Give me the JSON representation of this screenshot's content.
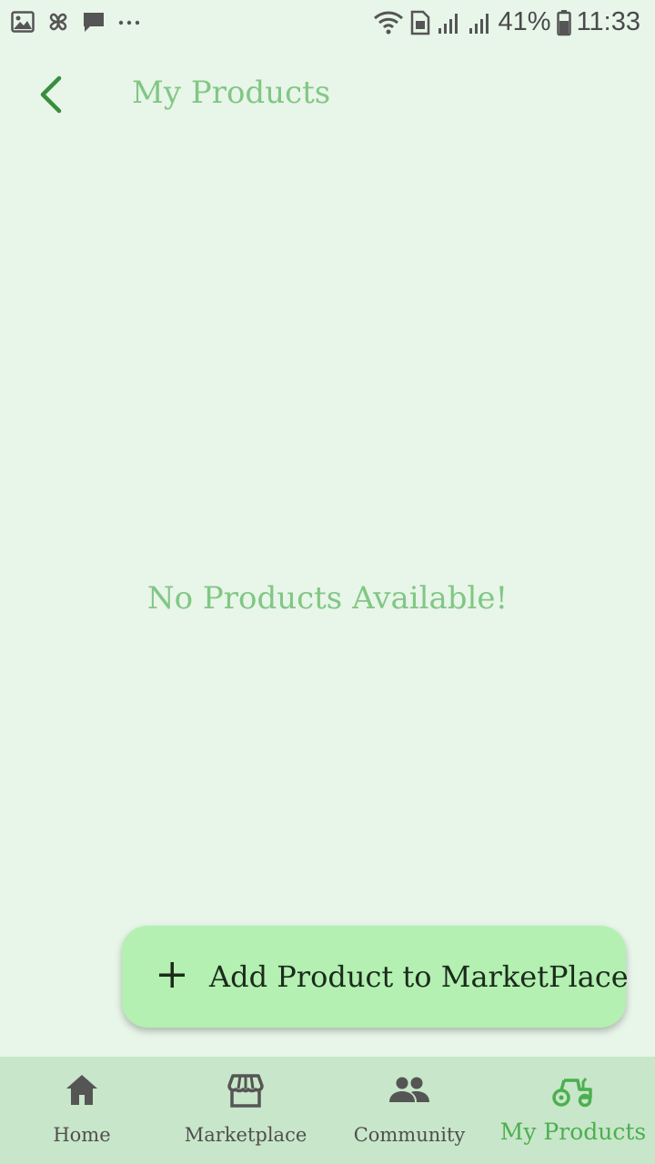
{
  "status_bar": {
    "battery": "41%",
    "time": "11:33",
    "icons": [
      "gallery-icon",
      "pinwheel-icon",
      "message-icon",
      "more-dots-icon",
      "wifi-icon",
      "sim-icon",
      "signal-icon",
      "signal-icon",
      "battery-icon"
    ]
  },
  "app_bar": {
    "title": "My Products",
    "back_icon": "chevron-left-icon"
  },
  "main": {
    "empty_message": "No Products Available!"
  },
  "fab": {
    "icon": "plus-icon",
    "label": "Add Product to MarketPlace"
  },
  "bottom_nav": {
    "items": [
      {
        "label": "Home",
        "icon": "home-icon",
        "active": false
      },
      {
        "label": "Marketplace",
        "icon": "storefront-icon",
        "active": false
      },
      {
        "label": "Community",
        "icon": "people-icon",
        "active": false
      },
      {
        "label": "My Products",
        "icon": "tractor-icon",
        "active": true
      }
    ]
  },
  "colors": {
    "background": "#e8f5e9",
    "accent": "#81c784",
    "active_nav": "#4caf50",
    "fab": "#b3f0b2",
    "nav_background": "#c8e6c9",
    "back_icon": "#388e3c"
  }
}
